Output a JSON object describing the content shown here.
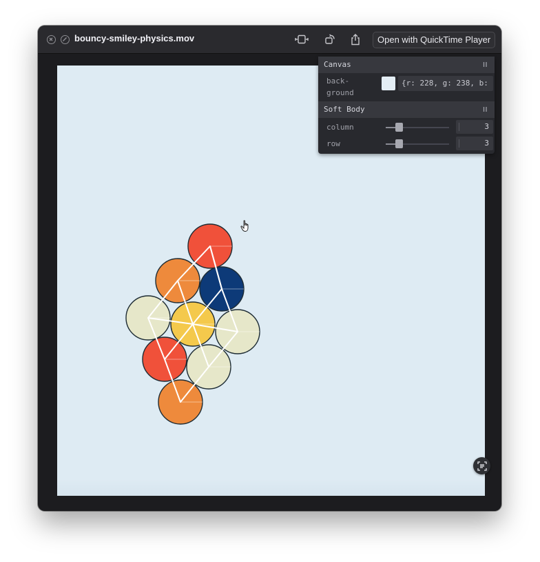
{
  "window": {
    "title": "bouncy-smiley-physics.mov",
    "open_button_label": "Open with QuickTime Player"
  },
  "panel": {
    "canvas_folder": {
      "title": "Canvas",
      "background_label_line1": "back-",
      "background_label_line2": "ground",
      "background_value": "{r: 228, g: 238, b:",
      "background_swatch_color": "#e4eef5"
    },
    "softbody_folder": {
      "title": "Soft Body",
      "column_label": "column",
      "column_value": "3",
      "row_label": "row",
      "row_value": "3"
    }
  },
  "colors": {
    "red": "#f0513a",
    "orange": "#ee8a3c",
    "navy": "#0d3a78",
    "yellow": "#f4c94c",
    "cream": "#e6e7c9"
  },
  "icons": [
    "close-icon",
    "slash-circle-icon",
    "trim-icon",
    "rotate-icon",
    "share-icon",
    "pause-icon",
    "live-text-icon",
    "hand-cursor-icon"
  ]
}
